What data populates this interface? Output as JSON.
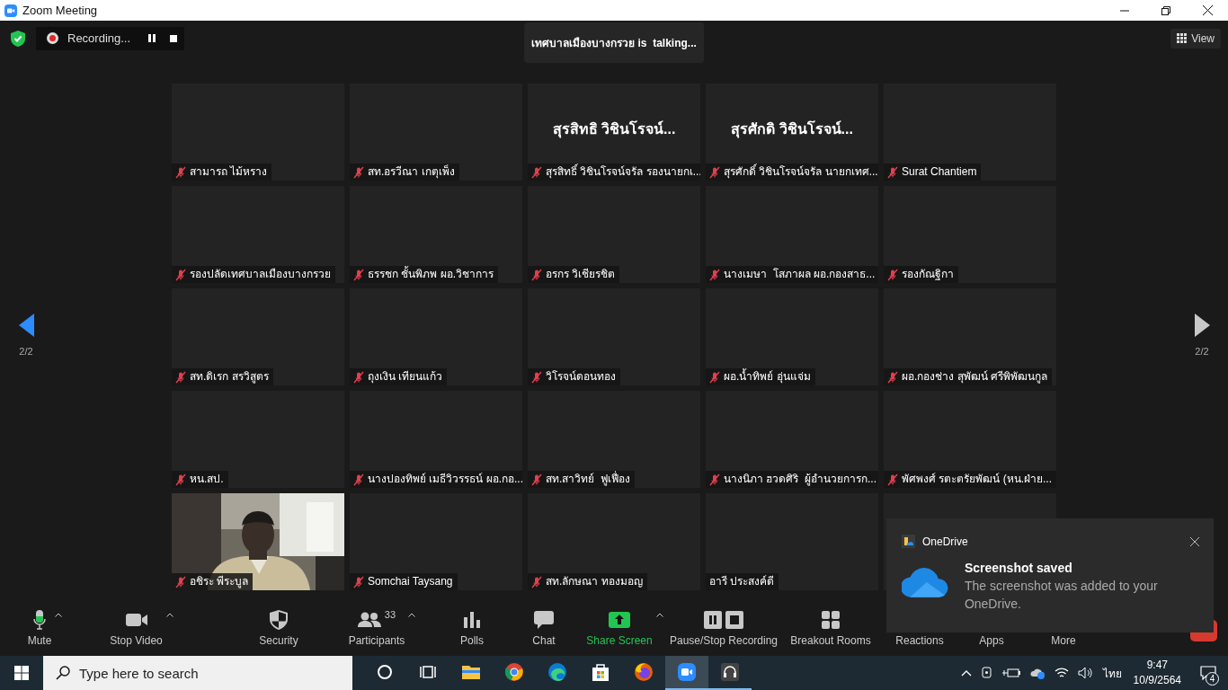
{
  "window": {
    "title": "Zoom Meeting"
  },
  "top_bar": {
    "recording": {
      "label": "Recording..."
    },
    "talking": "เทศบาลเมืองบางกรวย is  talking...",
    "view_button": "View"
  },
  "pager": {
    "previous": "2/2",
    "next": "2/2"
  },
  "tiles": [
    {
      "kind": "name",
      "name": "สามารถ ไม้หราง",
      "muted": true
    },
    {
      "kind": "name",
      "name": "สท.อรวีณา เกตุเพ็ง",
      "muted": true
    },
    {
      "kind": "name",
      "center_name": "สุรสิทธิ วิชินโรจน์...",
      "name": "สุรสิทธิ์ วิชินโรจน์จรัล รองนายกเ...",
      "muted": true
    },
    {
      "kind": "name",
      "center_name": "สุรศักดิ วิชินโรจน์...",
      "name": "สุรศักดิ์ วิชินโรจน์จรัล นายกเทศ...",
      "muted": true
    },
    {
      "kind": "name",
      "name": "Surat Chantiem",
      "muted": true
    },
    {
      "kind": "name",
      "name": "รองปลัดเทศบาลเมืองบางกรวย",
      "muted": true
    },
    {
      "kind": "name",
      "name": "ธรรชก ชั้นพิภพ ผอ.วิชาการ",
      "muted": true
    },
    {
      "kind": "name",
      "name": "อรกร วิเชียรชิต",
      "muted": true
    },
    {
      "kind": "name",
      "name": "นางเมษา  โสภาผล ผอ.กองสาธ...",
      "muted": true
    },
    {
      "kind": "name",
      "name": "รองกัณฐิกา",
      "muted": true
    },
    {
      "kind": "name",
      "name": "สท.ดิเรก สรวิสูตร",
      "muted": true
    },
    {
      "kind": "name",
      "name": "ถุงเงิน เทียนแก้ว",
      "muted": true
    },
    {
      "kind": "name",
      "name": "วิโรจน์ดอนทอง",
      "muted": true
    },
    {
      "kind": "name",
      "name": "ผอ.น้ำทิพย์ อุ่นแจ่ม",
      "muted": true
    },
    {
      "kind": "name",
      "name": "ผอ.กองช่าง สุพัฒน์ ศรีพิพัฒนกูล",
      "muted": true
    },
    {
      "kind": "name",
      "name": "หน.สป.",
      "muted": true
    },
    {
      "kind": "name",
      "name": "นางปองทิพย์ เมธีวิวรรธน์ ผอ.กอ...",
      "muted": true
    },
    {
      "kind": "name",
      "name": "สท.สาวิทย์  ฟูเฟื่อง",
      "muted": true
    },
    {
      "kind": "name",
      "name": "นางนิภา ฮวดศิริ  ผู้อำนวยการก...",
      "muted": true
    },
    {
      "kind": "name",
      "name": "พัศพงศ์ รตะตรัยพัฒน์ (หน.ฝ่าย...",
      "muted": true
    },
    {
      "kind": "video",
      "name": "อชิระ พีระบูล",
      "muted": true
    },
    {
      "kind": "name",
      "name": "Somchai Taysang",
      "muted": true
    },
    {
      "kind": "name",
      "name": "สท.ลักษณา ทองมอญ",
      "muted": true
    },
    {
      "kind": "name",
      "name": "อารี ประสงค์ดี",
      "muted": false
    },
    {
      "kind": "covered"
    }
  ],
  "toolbar": [
    {
      "label": "Mute",
      "caret": true
    },
    {
      "label": "Stop Video",
      "caret": true
    },
    {
      "label": "Security",
      "caret": false
    },
    {
      "label": "Participants",
      "count": "33",
      "caret": true
    },
    {
      "label": "Polls",
      "caret": false
    },
    {
      "label": "Chat",
      "caret": false
    },
    {
      "label": "Share Screen",
      "caret": true
    },
    {
      "label": "Pause/Stop Recording",
      "caret": false
    },
    {
      "label": "Breakout Rooms",
      "caret": false
    },
    {
      "label": "Reactions",
      "caret": false
    },
    {
      "label": "Apps",
      "caret": false
    },
    {
      "label": "More",
      "caret": false
    }
  ],
  "notification": {
    "app": "OneDrive",
    "title": "Screenshot saved",
    "body": "The screenshot was added to your OneDrive."
  },
  "taskbar": {
    "search": {
      "placeholder": "Type here to search"
    },
    "apps": [
      {
        "selected": false,
        "running": false
      },
      {
        "selected": false,
        "running": false
      },
      {
        "selected": false,
        "running": false
      },
      {
        "selected": false,
        "running": false
      },
      {
        "selected": false,
        "running": false
      },
      {
        "selected": false,
        "running": false
      },
      {
        "selected": false,
        "running": false
      },
      {
        "selected": true,
        "running": true
      },
      {
        "selected": false,
        "running": true
      }
    ],
    "language": "ไทย",
    "time": "9:47",
    "date": "10/9/2564",
    "notifications": "4"
  }
}
